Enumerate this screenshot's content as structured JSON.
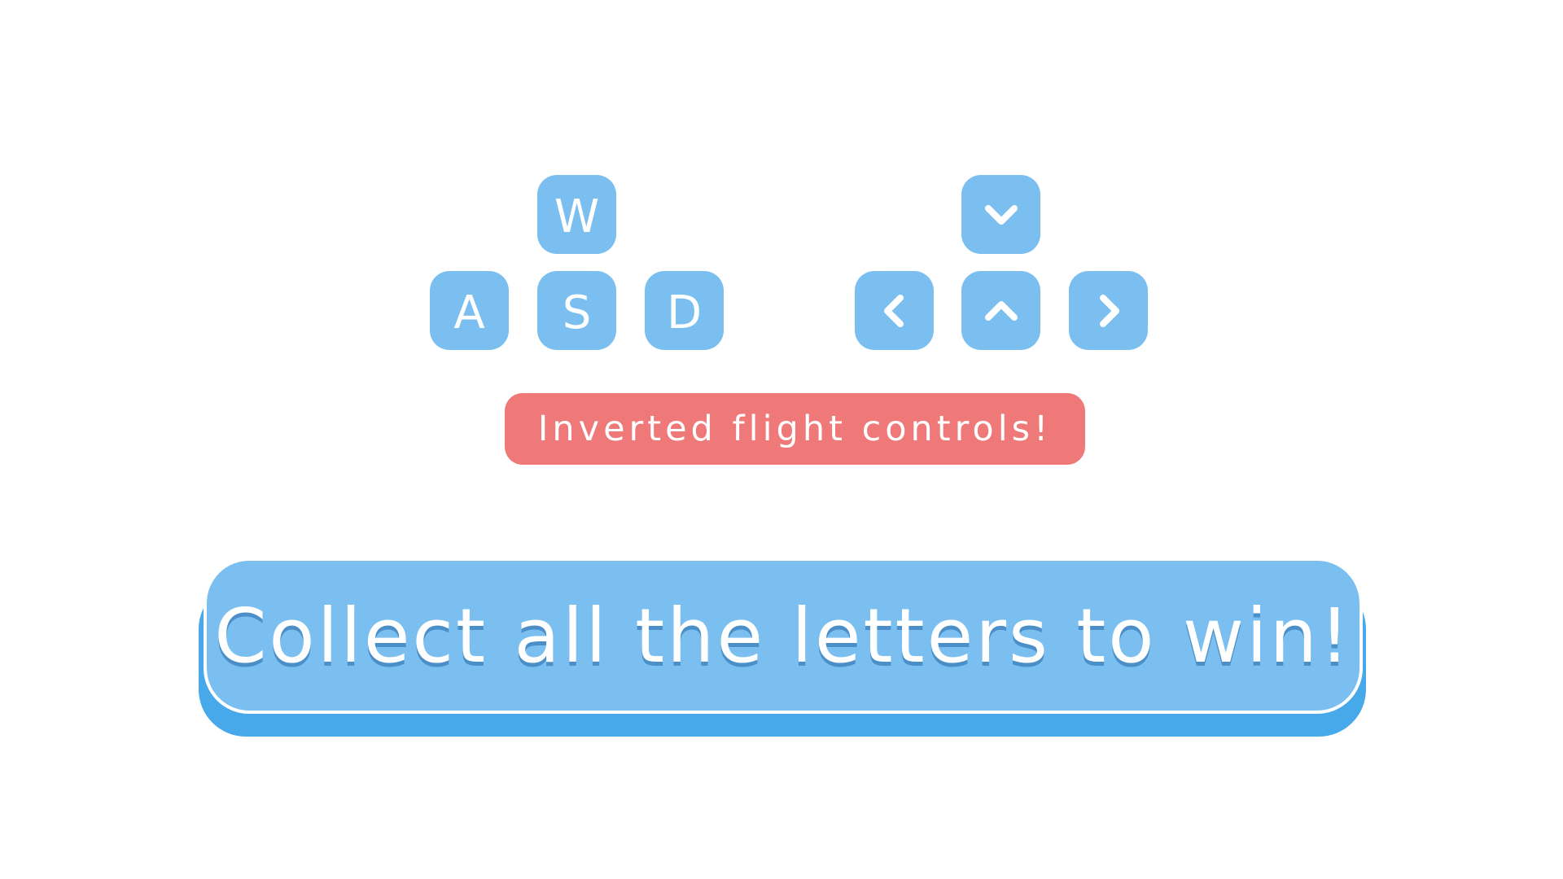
{
  "controls": {
    "wasd": {
      "up": "W",
      "left": "A",
      "down": "S",
      "right": "D"
    },
    "arrows": {
      "top_icon": "chevron-down-icon",
      "left_icon": "chevron-left-icon",
      "middle_icon": "chevron-up-icon",
      "right_icon": "chevron-right-icon"
    },
    "key_color": "#7bbff0",
    "glyph_color": "#ffffff"
  },
  "banner": {
    "text": "Inverted flight controls!",
    "color": "#ef7878"
  },
  "cta": {
    "label": "Collect all the letters to win!",
    "color": "#7bbff0",
    "shadow_color": "#47a8ea"
  }
}
